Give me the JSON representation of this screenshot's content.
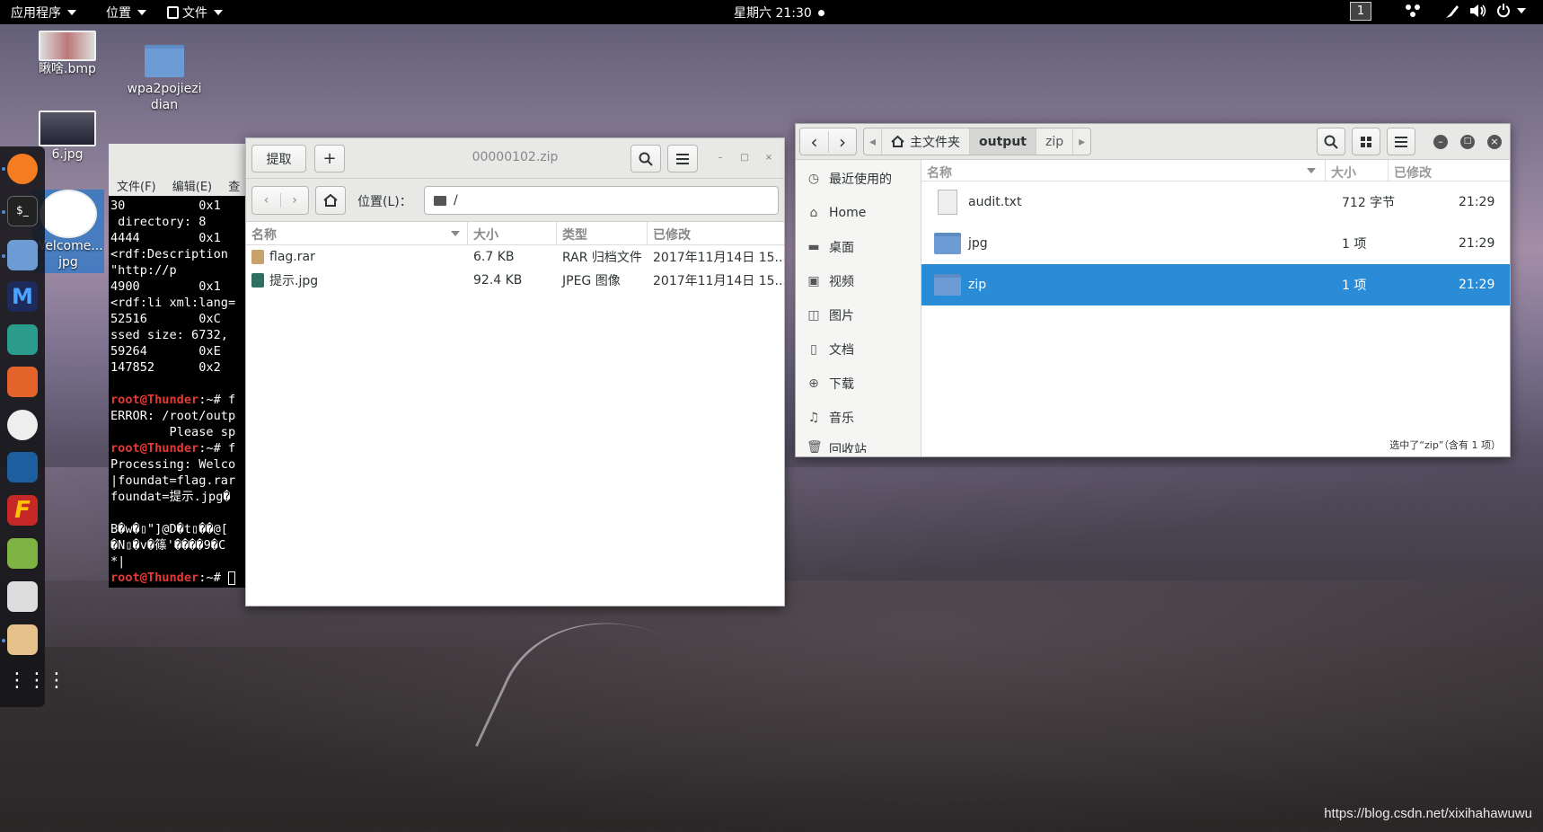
{
  "topbar": {
    "apps": "应用程序",
    "places": "位置",
    "files": "文件",
    "clock": "星期六 21:30",
    "workspace": "1"
  },
  "desktop": {
    "icons": [
      {
        "label": "瞅啥.bmp"
      },
      {
        "label": "wpa2pojiezi dian"
      },
      {
        "label": "6.jpg"
      },
      {
        "label": "Welcome... jpg"
      }
    ]
  },
  "terminal": {
    "menu": [
      "文件(F)",
      "编辑(E)",
      "查"
    ],
    "lines": [
      "30          0x1",
      " directory: 8",
      "4444        0x1",
      "<rdf:Description",
      "\"http://p",
      "4900        0x1",
      "<rdf:li xml:lang=",
      "52516       0xC",
      "ssed size: 6732,",
      "59264       0xE",
      "147852      0x2"
    ],
    "prompt": "root@Thunder",
    "cmds": [
      ":~# f",
      ":~# f",
      ":~# "
    ],
    "error1": "ERROR: /root/outp",
    "error2": "        Please sp",
    "proc1": "Processing: Welco",
    "proc2": "|foundat=flag.rar",
    "proc3": "foundat=提示.jpg�",
    "garb1": "B�w�▯\"]@D�t▯��@[",
    "garb2": "�N▯�v�篠'����9�C",
    "garb3": "*|"
  },
  "archive": {
    "title": "00000102.zip",
    "extract_label": "提取",
    "add_label": "+",
    "location_label": "位置(L)：",
    "path": "/",
    "columns": [
      "名称",
      "大小",
      "类型",
      "已修改"
    ],
    "rows": [
      {
        "name": "flag.rar",
        "size": "6.7 KB",
        "type": "RAR 归档文件",
        "modified": "2017年11月14日 15..."
      },
      {
        "name": "提示.jpg",
        "size": "92.4 KB",
        "type": "JPEG 图像",
        "modified": "2017年11月14日 15..."
      }
    ]
  },
  "files": {
    "breadcrumb": [
      "主文件夹",
      "output",
      "zip"
    ],
    "sidebar": [
      "最近使用的",
      "Home",
      "桌面",
      "视频",
      "图片",
      "文档",
      "下载",
      "音乐",
      "回收站"
    ],
    "columns": [
      "名称",
      "大小",
      "已修改"
    ],
    "rows": [
      {
        "name": "audit.txt",
        "size": "712 字节",
        "modified": "21:29"
      },
      {
        "name": "jpg",
        "size": "1 项",
        "modified": "21:29"
      },
      {
        "name": "zip",
        "size": "1 项",
        "modified": "21:29"
      }
    ],
    "status": "选中了“zip”（含有 1 项）",
    "colors": {
      "selection": "#2a8cd6"
    }
  },
  "watermark": "https://blog.csdn.net/xixihahawuwu"
}
